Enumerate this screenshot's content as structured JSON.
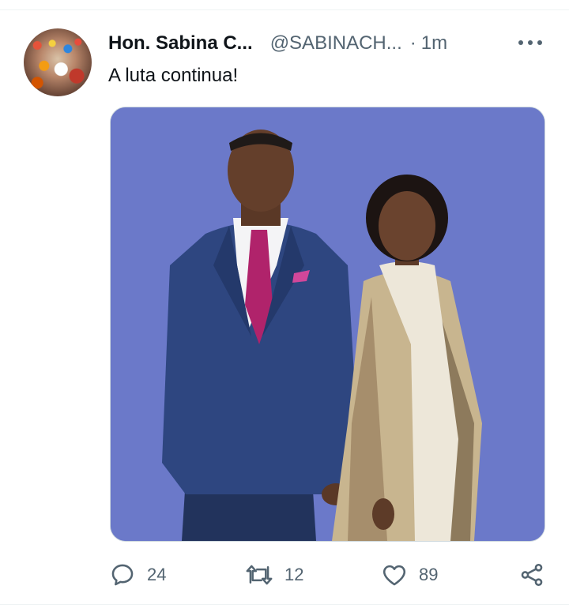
{
  "tweet": {
    "author_name": "Hon. Sabina C...",
    "author_handle": "@SABINACH...",
    "separator": "·",
    "time": "1m",
    "text": "A luta continua!",
    "avatar_icon": "profile-photo",
    "media_background": "#6b79c9"
  },
  "actions": {
    "reply_count": "24",
    "retweet_count": "12",
    "like_count": "89",
    "reply_icon": "comment-icon",
    "retweet_icon": "retweet-icon",
    "like_icon": "heart-icon",
    "share_icon": "share-icon"
  },
  "colors": {
    "text_primary": "#0f1419",
    "text_secondary": "#536471",
    "divider": "#eff3f4"
  }
}
